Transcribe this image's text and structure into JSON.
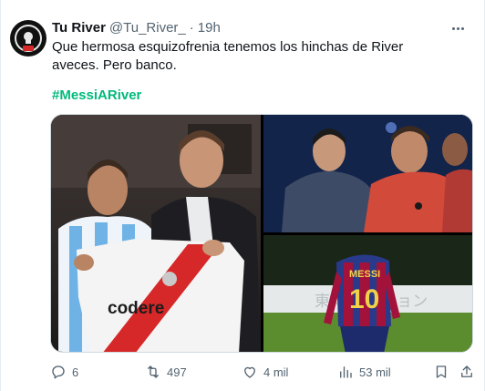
{
  "tweet": {
    "display_name": "Tu River",
    "handle": "@Tu_River_",
    "separator": "·",
    "time": "19h",
    "text": "Que hermosa esquizofrenia tenemos los hinchas de River aveces. Pero banco.",
    "hashtag": "#MessiARiver",
    "media": {
      "photo1_shirt_text": "codere",
      "photo3_jersey_name": "MESSI",
      "photo3_jersey_number": "10",
      "photo3_banner_text": "東 ボレーション"
    },
    "counts": {
      "replies": "6",
      "reposts": "497",
      "likes": "4 mil",
      "views": "53 mil"
    }
  },
  "icons": {
    "more": "more-horizontal-icon",
    "reply": "reply-icon",
    "repost": "repost-icon",
    "like": "heart-icon",
    "views": "views-icon",
    "bookmark": "bookmark-icon",
    "share": "share-icon"
  },
  "colors": {
    "hashtag": "#00ba7c",
    "secondary_text": "#536471",
    "primary_text": "#0f1419",
    "river_red": "#d62828"
  }
}
